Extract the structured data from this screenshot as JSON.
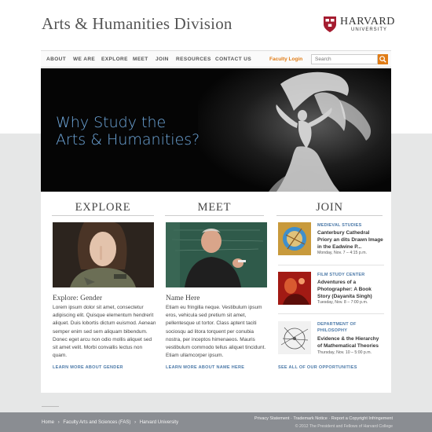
{
  "header": {
    "site_title": "Arts & Humanities Division",
    "logo_word": "HARVARD",
    "logo_sub": "UNIVERSITY"
  },
  "nav": {
    "items": [
      "ABOUT",
      "WE ARE",
      "EXPLORE",
      "MEET",
      "JOIN",
      "RESOURCES",
      "CONTACT US"
    ],
    "login": "Faculty Login",
    "search_placeholder": "Search",
    "search_icon": "search-icon"
  },
  "hero": {
    "line1": "Why Study the",
    "line2": "Arts & Humanities?"
  },
  "columns": {
    "explore": {
      "heading": "EXPLORE",
      "title": "Explore: Gender",
      "body": "Lorem ipsum dolor sit amet, consectetur adipiscing elit. Quisque elementum hendrerit aliquet. Duis lobortis dictum euismod. Aenean semper enim sed sem aliquam bibendum. Donec eget arcu non odio mollis aliquet sed sit amet velit. Morbi convallis lectus non quam.",
      "link": "LEARN MORE ABOUT GENDER"
    },
    "meet": {
      "heading": "MEET",
      "title": "Name Here",
      "body": "Etiam eu fringilla neque. Vestibulum ipsum eros, vehicula sed pretium sit amet, pellentesque ut tortor. Class aptent taciti sociosqu ad litora torquent per conubia nostra, per inceptos himenaeos. Mauris vestibulum commodo tellus aliquet tincidunt. Etiam ullamcorper ipsum.",
      "link": "LEARN MORE ABOUT NAME HERE"
    },
    "join": {
      "heading": "JOIN",
      "items": [
        {
          "category": "MEDIEVAL STUDIES",
          "title": "Canterbury Cathedral Priory an dits Drawn Image in the Eadwine P...",
          "date": "Monday, Nov. 7 – 4:15 p.m."
        },
        {
          "category": "FILM STUDY CENTER",
          "title": "Adventures of a Photographer: A Book Story (Dayanita Singh)",
          "date": "Tuesday, Nov. 8 – 7:00 p.m."
        },
        {
          "category": "DEPARTMENT OF PHILOSOPHY",
          "title": "Evidence & the Hierarchy of Mathematical Theories",
          "date": "Thursday, Nov. 10 – 5:00 p.m."
        }
      ],
      "link": "SEE ALL OF OUR OPPORTUNITIES"
    }
  },
  "footer": {
    "breadcrumb": [
      "Home",
      "Faculty Arts and Sciences (FAS)",
      "Harvard University"
    ],
    "separator": "›",
    "links": [
      "Privacy Statement",
      "Trademark Notice",
      "Report a Copyright Infringement"
    ],
    "link_separator": "·",
    "copyright": "© 2012 The President and Fellows of Harvard College"
  },
  "colors": {
    "accent_orange": "#e07c16",
    "link_blue": "#4b79a8",
    "hero_text": "#6fa8dc",
    "footer_bg": "#8a8d92",
    "crimson": "#a51c30"
  }
}
